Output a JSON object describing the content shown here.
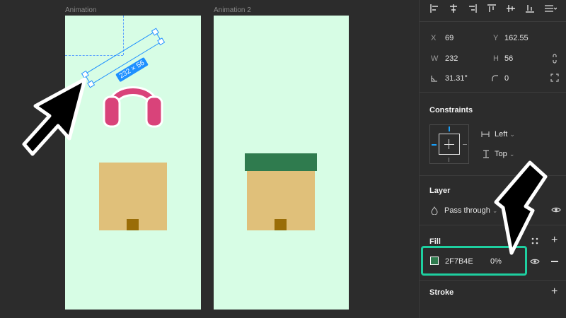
{
  "canvas": {
    "frames": [
      {
        "label": "Animation"
      },
      {
        "label": "Animation 2"
      }
    ],
    "selection_size": "232 × 56"
  },
  "panel": {
    "align_icons": [
      "align-left-icon",
      "align-h-center-icon",
      "align-right-icon",
      "align-top-icon",
      "align-v-center-icon",
      "align-bottom-icon",
      "distribute-icon"
    ],
    "x_label": "X",
    "x_value": "69",
    "y_label": "Y",
    "y_value": "162.55",
    "w_label": "W",
    "w_value": "232",
    "h_label": "H",
    "h_value": "56",
    "rotation_value": "31.31°",
    "radius_value": "0",
    "constraints_title": "Constraints",
    "constraint_h": "Left",
    "constraint_v": "Top",
    "layer_title": "Layer",
    "blend_mode": "Pass through",
    "fill_title": "Fill",
    "fill_hex": "2F7B4E",
    "fill_opacity": "0%",
    "stroke_title": "Stroke"
  },
  "colors": {
    "frame_bg": "#d7fde5",
    "headphones": "#d9437a",
    "box": "#e0c07a",
    "box_lid": "#2f7b4e",
    "box_hole": "#9a6d07",
    "selection": "#1e90ff",
    "highlight": "#1ecfa0",
    "fill_swatch": "#2f7b4e"
  }
}
